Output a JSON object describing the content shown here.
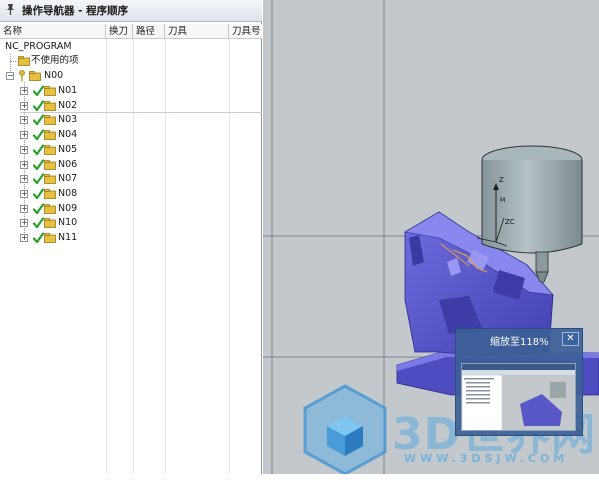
{
  "navigator": {
    "title": "操作导航器 - 程序顺序",
    "columns": [
      "名称",
      "换刀",
      "路径",
      "刀具",
      "刀具号"
    ],
    "root": "NC_PROGRAM",
    "unused": "不使用的项",
    "group": "N00",
    "operations": [
      "N01",
      "N02",
      "N03",
      "N04",
      "N05",
      "N06",
      "N07",
      "N08",
      "N09",
      "N10",
      "N11"
    ]
  },
  "zoom_popup": {
    "text": "缩放至118%",
    "close_symbol": "✕"
  },
  "axes": {
    "z": "Z",
    "zc": "ZC",
    "m": "M"
  },
  "watermark": {
    "main": "3D世界网",
    "sub": "WWW.3DSJW.COM"
  },
  "icons": [
    "pin-icon",
    "expand-plus-icon",
    "check-icon",
    "program-folder-icon",
    "key-icon",
    "close-icon"
  ],
  "colors": {
    "check": "#2aa12a",
    "folder": "#e8c040",
    "part": "#5a58c8",
    "tool": "#9ba6a8",
    "viewport": "#c3c8cd",
    "popup": "#3c5f96"
  }
}
